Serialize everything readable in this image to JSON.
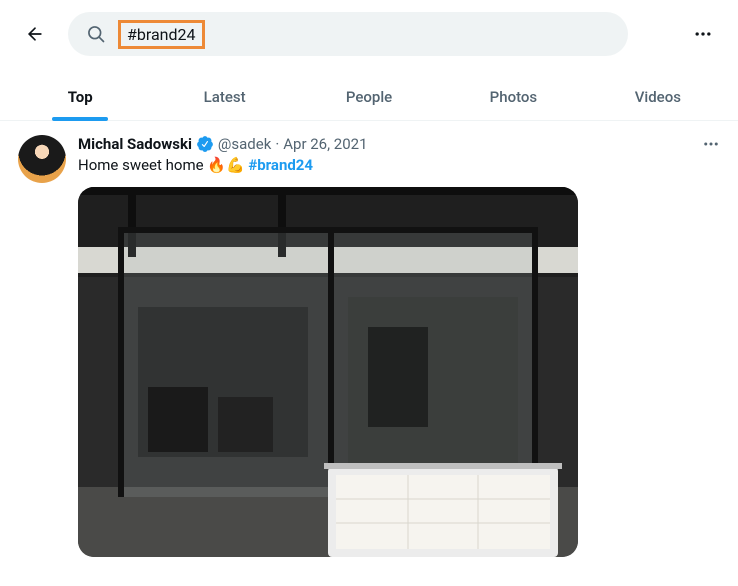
{
  "header": {
    "search_query": "#brand24"
  },
  "tabs": [
    {
      "label": "Top",
      "active": true
    },
    {
      "label": "Latest",
      "active": false
    },
    {
      "label": "People",
      "active": false
    },
    {
      "label": "Photos",
      "active": false
    },
    {
      "label": "Videos",
      "active": false
    }
  ],
  "tweet": {
    "display_name": "Michal Sadowski",
    "handle": "@sadek",
    "separator": "·",
    "date": "Apr 26, 2021",
    "text_prefix": "Home sweet home 🔥💪 ",
    "hashtag": "#brand24"
  }
}
